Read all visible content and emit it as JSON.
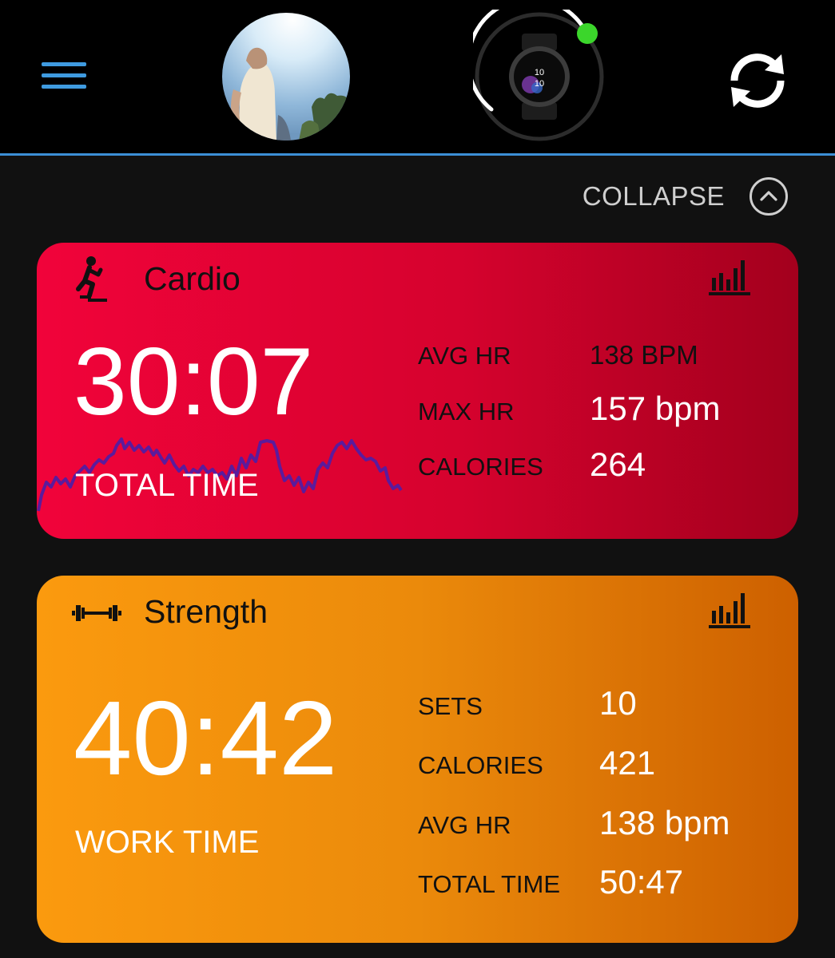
{
  "header": {
    "menu_icon": "hamburger-menu-icon",
    "avatar_icon": "profile-photo",
    "device_icon": "smartwatch-icon",
    "device_status_color": "#3bd62b",
    "sync_icon": "sync-icon",
    "accent_color": "#3c8fd6",
    "watch_face_time": [
      "10",
      "10"
    ]
  },
  "collapse": {
    "label": "COLLAPSE",
    "icon": "chevron-up-circle-icon"
  },
  "cardio": {
    "title": "Cardio",
    "icon": "stair-climber-icon",
    "chart_icon": "bar-chart-icon",
    "main_value": "30:07",
    "main_label": "TOTAL TIME",
    "color": "#e8042f",
    "stats": [
      {
        "label": "AVG HR",
        "value": "138 BPM"
      },
      {
        "label": "MAX HR",
        "value": "157 bpm"
      },
      {
        "label": "CALORIES",
        "value": "264"
      }
    ]
  },
  "strength": {
    "title": "Strength",
    "icon": "dumbbell-icon",
    "chart_icon": "bar-chart-icon",
    "main_value": "40:42",
    "main_label": "WORK TIME",
    "color": "#f2910c",
    "stats": [
      {
        "label": "SETS",
        "value": "10"
      },
      {
        "label": "CALORIES",
        "value": "421"
      },
      {
        "label": "AVG HR",
        "value": "138 bpm"
      },
      {
        "label": "TOTAL TIME",
        "value": "50:47"
      }
    ]
  }
}
